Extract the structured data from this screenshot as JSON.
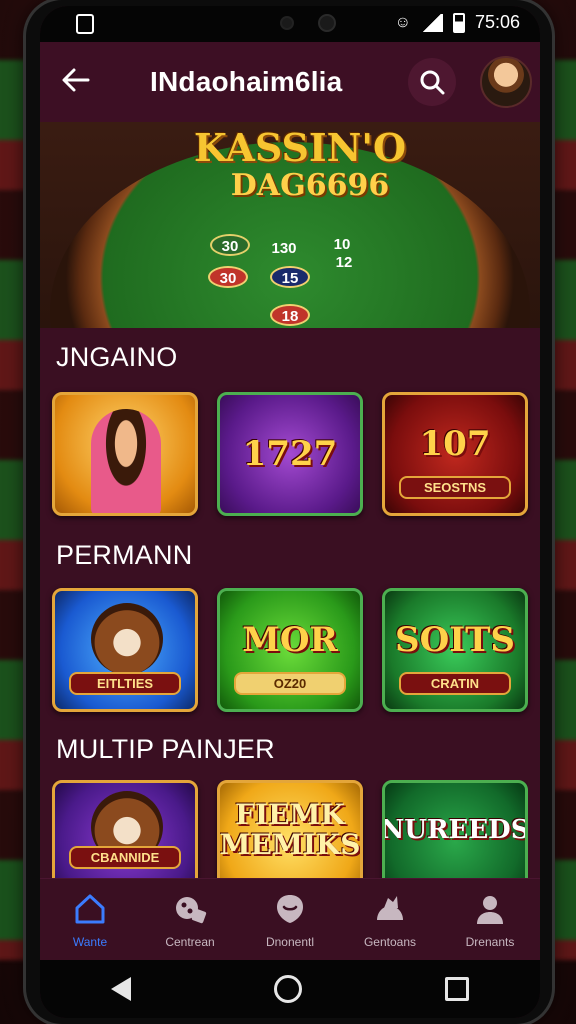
{
  "status_bar": {
    "time": "75:06"
  },
  "app_bar": {
    "title": "INdaohaim6lia"
  },
  "hero": {
    "title": "KASSIN'O",
    "subtitle": "DAG6696",
    "chips": [
      "30",
      "130",
      "10",
      "12",
      "30",
      "15",
      "18"
    ]
  },
  "sections": [
    {
      "title": "JNGAINO",
      "tiles": [
        {
          "label": "",
          "sub": "",
          "style": "t-gold",
          "figure": "face"
        },
        {
          "label": "1727",
          "sub": "",
          "style": "t-purple"
        },
        {
          "label": "107",
          "sub": "SEOSTNS",
          "style": "t-red"
        }
      ]
    },
    {
      "title": "PERMANN",
      "tiles": [
        {
          "label": "",
          "sub": "EITLTIES",
          "style": "t-blue",
          "figure": "dog"
        },
        {
          "label": "MOR",
          "sub": "OZ20",
          "style": "t-green"
        },
        {
          "label": "SOITS",
          "sub": "CRATIN",
          "style": "t-green2"
        }
      ]
    },
    {
      "title": "MULTIP PAINJER",
      "tiles": [
        {
          "label": "",
          "sub": "CBANNIDE",
          "style": "t-violet",
          "figure": "dog"
        },
        {
          "label": "FIEMK MEMIKS",
          "sub": "",
          "style": "t-yellow"
        },
        {
          "label": "NUREEDS",
          "sub": "",
          "style": "t-emerald"
        }
      ]
    }
  ],
  "bottom_nav": [
    {
      "label": "Wante",
      "icon": "home-icon",
      "active": true
    },
    {
      "label": "Centrean",
      "icon": "games-icon",
      "active": false
    },
    {
      "label": "Dnonentl",
      "icon": "rewards-icon",
      "active": false
    },
    {
      "label": "Gentoans",
      "icon": "cards-icon",
      "active": false
    },
    {
      "label": "Drenants",
      "icon": "profile-icon",
      "active": false
    }
  ],
  "colors": {
    "accent": "#3b7cff",
    "background": "#3a0f22",
    "gold": "#e4a63a"
  }
}
